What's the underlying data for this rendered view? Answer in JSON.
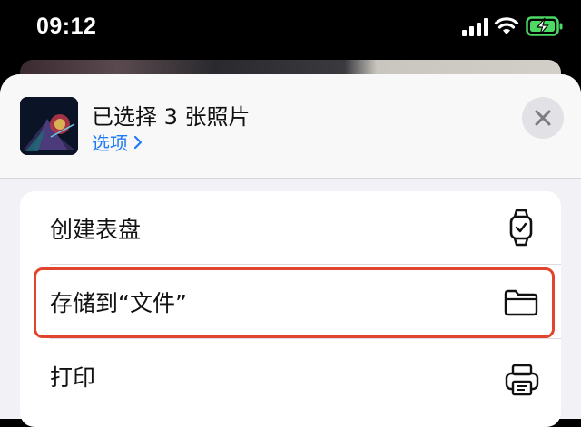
{
  "status_bar": {
    "time": "09:12",
    "icons": [
      "cellular-signal-icon",
      "wifi-icon",
      "battery-charging-icon"
    ]
  },
  "share_sheet": {
    "title": "已选择 3 张照片",
    "options_label": "选项",
    "close_icon": "close-icon",
    "actions": [
      {
        "label": "创建表盘",
        "icon": "watch-icon"
      },
      {
        "label": "存储到“文件”",
        "icon": "folder-icon",
        "highlighted": true
      },
      {
        "label": "打印",
        "icon": "printer-icon"
      }
    ]
  },
  "colors": {
    "accent": "#1f7cf4",
    "highlight_border": "#e2452e",
    "battery_green": "#4cd964"
  }
}
